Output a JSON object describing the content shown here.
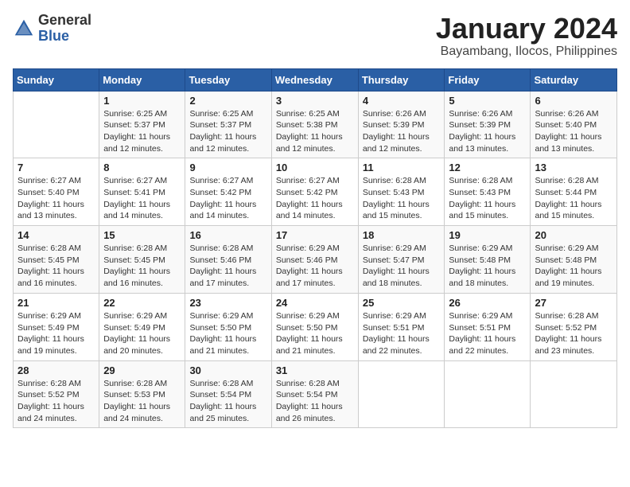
{
  "header": {
    "logo_general": "General",
    "logo_blue": "Blue",
    "month_title": "January 2024",
    "location": "Bayambang, Ilocos, Philippines"
  },
  "days_of_week": [
    "Sunday",
    "Monday",
    "Tuesday",
    "Wednesday",
    "Thursday",
    "Friday",
    "Saturday"
  ],
  "weeks": [
    [
      {
        "num": "",
        "info": ""
      },
      {
        "num": "1",
        "info": "Sunrise: 6:25 AM\nSunset: 5:37 PM\nDaylight: 11 hours and 12 minutes."
      },
      {
        "num": "2",
        "info": "Sunrise: 6:25 AM\nSunset: 5:37 PM\nDaylight: 11 hours and 12 minutes."
      },
      {
        "num": "3",
        "info": "Sunrise: 6:25 AM\nSunset: 5:38 PM\nDaylight: 11 hours and 12 minutes."
      },
      {
        "num": "4",
        "info": "Sunrise: 6:26 AM\nSunset: 5:39 PM\nDaylight: 11 hours and 12 minutes."
      },
      {
        "num": "5",
        "info": "Sunrise: 6:26 AM\nSunset: 5:39 PM\nDaylight: 11 hours and 13 minutes."
      },
      {
        "num": "6",
        "info": "Sunrise: 6:26 AM\nSunset: 5:40 PM\nDaylight: 11 hours and 13 minutes."
      }
    ],
    [
      {
        "num": "7",
        "info": "Sunrise: 6:27 AM\nSunset: 5:40 PM\nDaylight: 11 hours and 13 minutes."
      },
      {
        "num": "8",
        "info": "Sunrise: 6:27 AM\nSunset: 5:41 PM\nDaylight: 11 hours and 14 minutes."
      },
      {
        "num": "9",
        "info": "Sunrise: 6:27 AM\nSunset: 5:42 PM\nDaylight: 11 hours and 14 minutes."
      },
      {
        "num": "10",
        "info": "Sunrise: 6:27 AM\nSunset: 5:42 PM\nDaylight: 11 hours and 14 minutes."
      },
      {
        "num": "11",
        "info": "Sunrise: 6:28 AM\nSunset: 5:43 PM\nDaylight: 11 hours and 15 minutes."
      },
      {
        "num": "12",
        "info": "Sunrise: 6:28 AM\nSunset: 5:43 PM\nDaylight: 11 hours and 15 minutes."
      },
      {
        "num": "13",
        "info": "Sunrise: 6:28 AM\nSunset: 5:44 PM\nDaylight: 11 hours and 15 minutes."
      }
    ],
    [
      {
        "num": "14",
        "info": "Sunrise: 6:28 AM\nSunset: 5:45 PM\nDaylight: 11 hours and 16 minutes."
      },
      {
        "num": "15",
        "info": "Sunrise: 6:28 AM\nSunset: 5:45 PM\nDaylight: 11 hours and 16 minutes."
      },
      {
        "num": "16",
        "info": "Sunrise: 6:28 AM\nSunset: 5:46 PM\nDaylight: 11 hours and 17 minutes."
      },
      {
        "num": "17",
        "info": "Sunrise: 6:29 AM\nSunset: 5:46 PM\nDaylight: 11 hours and 17 minutes."
      },
      {
        "num": "18",
        "info": "Sunrise: 6:29 AM\nSunset: 5:47 PM\nDaylight: 11 hours and 18 minutes."
      },
      {
        "num": "19",
        "info": "Sunrise: 6:29 AM\nSunset: 5:48 PM\nDaylight: 11 hours and 18 minutes."
      },
      {
        "num": "20",
        "info": "Sunrise: 6:29 AM\nSunset: 5:48 PM\nDaylight: 11 hours and 19 minutes."
      }
    ],
    [
      {
        "num": "21",
        "info": "Sunrise: 6:29 AM\nSunset: 5:49 PM\nDaylight: 11 hours and 19 minutes."
      },
      {
        "num": "22",
        "info": "Sunrise: 6:29 AM\nSunset: 5:49 PM\nDaylight: 11 hours and 20 minutes."
      },
      {
        "num": "23",
        "info": "Sunrise: 6:29 AM\nSunset: 5:50 PM\nDaylight: 11 hours and 21 minutes."
      },
      {
        "num": "24",
        "info": "Sunrise: 6:29 AM\nSunset: 5:50 PM\nDaylight: 11 hours and 21 minutes."
      },
      {
        "num": "25",
        "info": "Sunrise: 6:29 AM\nSunset: 5:51 PM\nDaylight: 11 hours and 22 minutes."
      },
      {
        "num": "26",
        "info": "Sunrise: 6:29 AM\nSunset: 5:51 PM\nDaylight: 11 hours and 22 minutes."
      },
      {
        "num": "27",
        "info": "Sunrise: 6:28 AM\nSunset: 5:52 PM\nDaylight: 11 hours and 23 minutes."
      }
    ],
    [
      {
        "num": "28",
        "info": "Sunrise: 6:28 AM\nSunset: 5:52 PM\nDaylight: 11 hours and 24 minutes."
      },
      {
        "num": "29",
        "info": "Sunrise: 6:28 AM\nSunset: 5:53 PM\nDaylight: 11 hours and 24 minutes."
      },
      {
        "num": "30",
        "info": "Sunrise: 6:28 AM\nSunset: 5:54 PM\nDaylight: 11 hours and 25 minutes."
      },
      {
        "num": "31",
        "info": "Sunrise: 6:28 AM\nSunset: 5:54 PM\nDaylight: 11 hours and 26 minutes."
      },
      {
        "num": "",
        "info": ""
      },
      {
        "num": "",
        "info": ""
      },
      {
        "num": "",
        "info": ""
      }
    ]
  ]
}
